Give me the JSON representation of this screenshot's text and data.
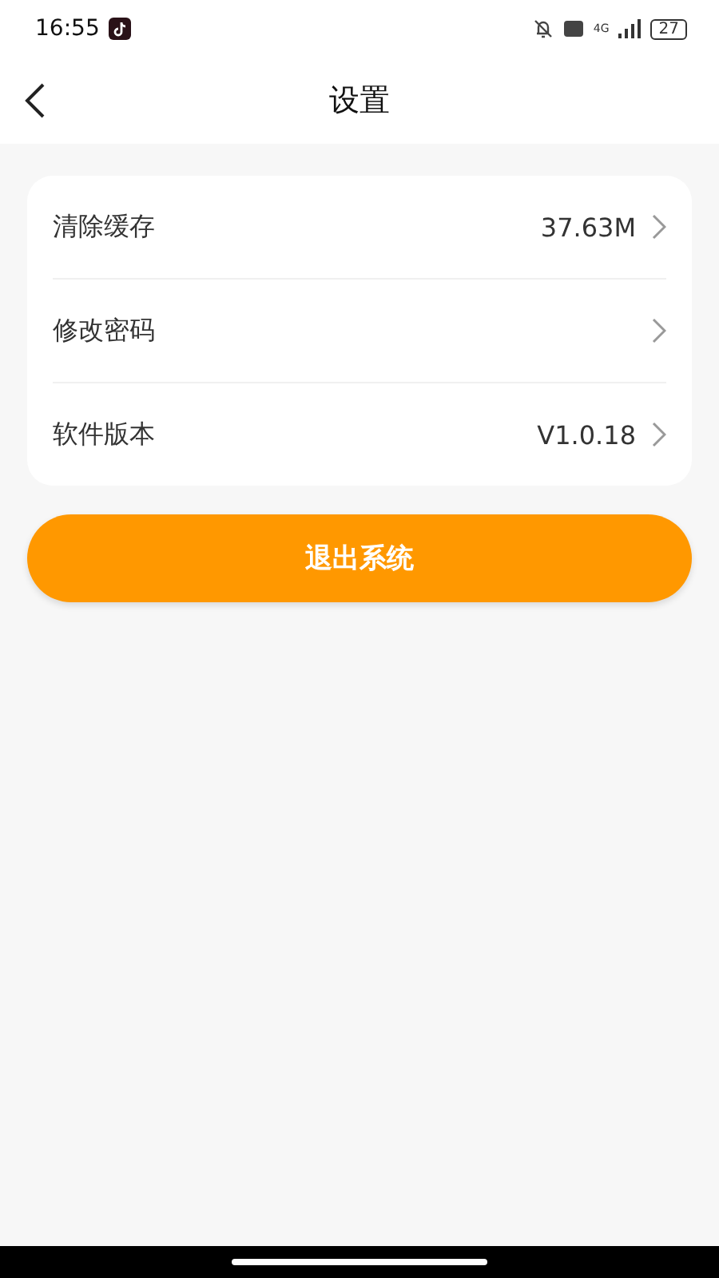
{
  "status_bar": {
    "time": "16:55",
    "network": "4G",
    "battery": "27"
  },
  "header": {
    "title": "设置"
  },
  "settings": [
    {
      "label": "清除缓存",
      "value": "37.63M"
    },
    {
      "label": "修改密码"
    },
    {
      "label": "软件版本",
      "value": "V1.0.18"
    }
  ],
  "logout_button": "退出系统"
}
